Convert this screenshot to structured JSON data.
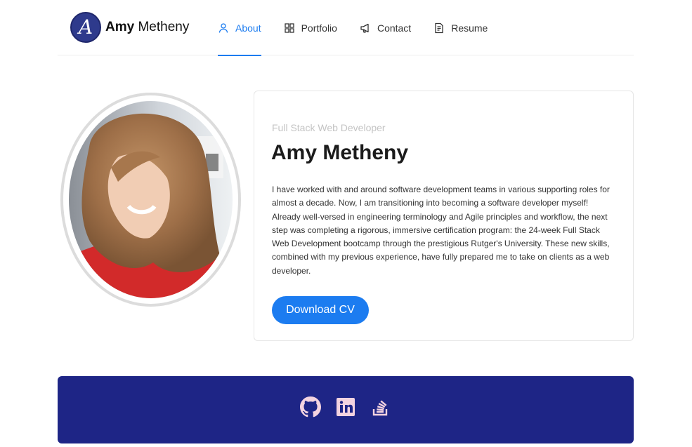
{
  "brand": {
    "logo_letter": "A",
    "first_name": "Amy",
    "last_name": "Metheny"
  },
  "nav": {
    "items": [
      {
        "label": "About",
        "icon": "user-icon",
        "active": true
      },
      {
        "label": "Portfolio",
        "icon": "grid-icon",
        "active": false
      },
      {
        "label": "Contact",
        "icon": "megaphone-icon",
        "active": false
      },
      {
        "label": "Resume",
        "icon": "document-icon",
        "active": false
      }
    ]
  },
  "about": {
    "subtitle": "Full Stack Web Developer",
    "name": "Amy Metheny",
    "bio": "I have worked with and around software development teams in various supporting roles for almost a decade. Now, I am transitioning into becoming a software developer myself! Already well-versed in engineering terminology and Agile principles and workflow, the next step was completing a rigorous, immersive certification program: the 24-week Full Stack Web Development bootcamp through the prestigious Rutger's University. These new skills, combined with my previous experience, have fully prepared me to take on clients as a web developer.",
    "button_label": "Download CV"
  },
  "footer": {
    "links": [
      {
        "name": "GitHub",
        "icon": "github-icon"
      },
      {
        "name": "LinkedIn",
        "icon": "linkedin-icon"
      },
      {
        "name": "Stack Overflow",
        "icon": "stackoverflow-icon"
      }
    ]
  },
  "colors": {
    "accent": "#1c7cf0",
    "footer_bg": "#1e2586",
    "logo_bg": "#2e3a8c",
    "footer_icons": "#f3d3e0"
  }
}
